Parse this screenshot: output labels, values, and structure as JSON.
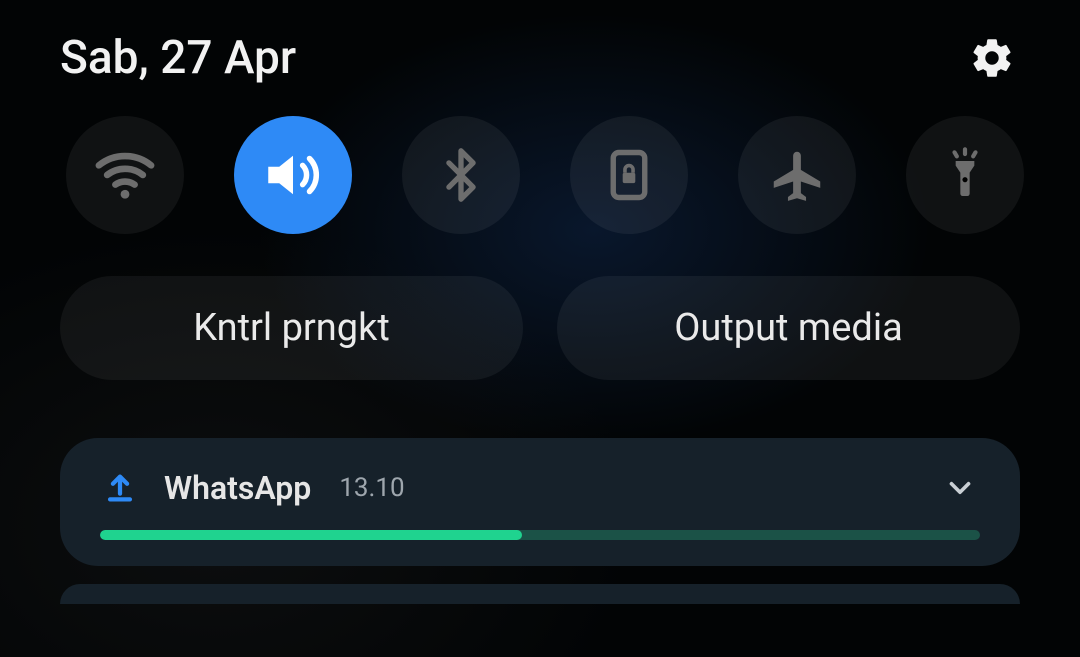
{
  "header": {
    "date": "Sab, 27 Apr",
    "settings_icon": "gear-icon"
  },
  "toggles": [
    {
      "name": "wifi",
      "icon": "wifi-icon",
      "active": false
    },
    {
      "name": "sound",
      "icon": "sound-icon",
      "active": true
    },
    {
      "name": "bluetooth",
      "icon": "bluetooth-icon",
      "active": false
    },
    {
      "name": "rotate-lock",
      "icon": "rotate-lock-icon",
      "active": false
    },
    {
      "name": "airplane",
      "icon": "airplane-icon",
      "active": false
    },
    {
      "name": "flashlight",
      "icon": "flashlight-icon",
      "active": false
    }
  ],
  "pills": {
    "device_control_label": "Kntrl prngkt",
    "media_output_label": "Output media"
  },
  "notification": {
    "app": "WhatsApp",
    "time": "13.10",
    "icon": "upload-icon",
    "progress_pct": 48,
    "accent": "#1fd38f",
    "track": "#1b5247"
  }
}
